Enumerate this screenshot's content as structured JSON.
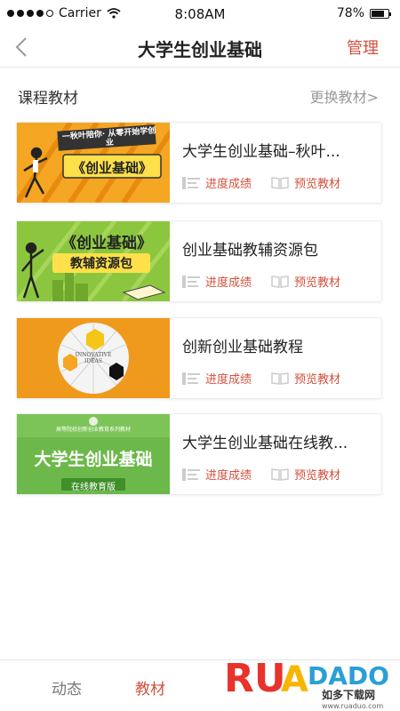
{
  "status_bar": {
    "carrier": "Carrier",
    "time": "8:08AM",
    "battery": "78%",
    "battery_level": 0.78
  },
  "nav": {
    "title": "大学生创业基础",
    "action": "管理",
    "back_icon": "chevron-left-icon"
  },
  "section": {
    "title": "课程教材",
    "link": "更换教材>"
  },
  "cards": [
    {
      "title": "大学生创业基础–秋叶...",
      "thumb_text_top": "一秋叶陪你· 从零开始学创业",
      "thumb_text_main": "《创业基础》",
      "progress_label": "进度成绩",
      "preview_label": "预览教材"
    },
    {
      "title": "创业基础教辅资源包",
      "thumb_text_main": "《创业基础》",
      "thumb_text_sub": "教辅资源包",
      "progress_label": "进度成绩",
      "preview_label": "预览教材"
    },
    {
      "title": "创新创业基础教程",
      "thumb_text_main": "INNOVATIVE IDEAS",
      "progress_label": "进度成绩",
      "preview_label": "预览教材"
    },
    {
      "title": "大学生创业基础在线教...",
      "thumb_text_top": "高等院校创新创业教育系列教材",
      "thumb_text_main": "大学生创业基础",
      "thumb_text_sub": "在线教育版",
      "progress_label": "进度成绩",
      "preview_label": "预览教材"
    }
  ],
  "tabs": [
    {
      "label": "动态",
      "active": false
    },
    {
      "label": "教材",
      "active": true
    }
  ],
  "watermark": {
    "brand": "RUANDADO",
    "cn": "如多下载网",
    "url": "www.ruaduo.com"
  },
  "colors": {
    "accent": "#d2503c",
    "muted": "#999999",
    "orange": "#f09a1d",
    "green": "#8cc63f"
  }
}
